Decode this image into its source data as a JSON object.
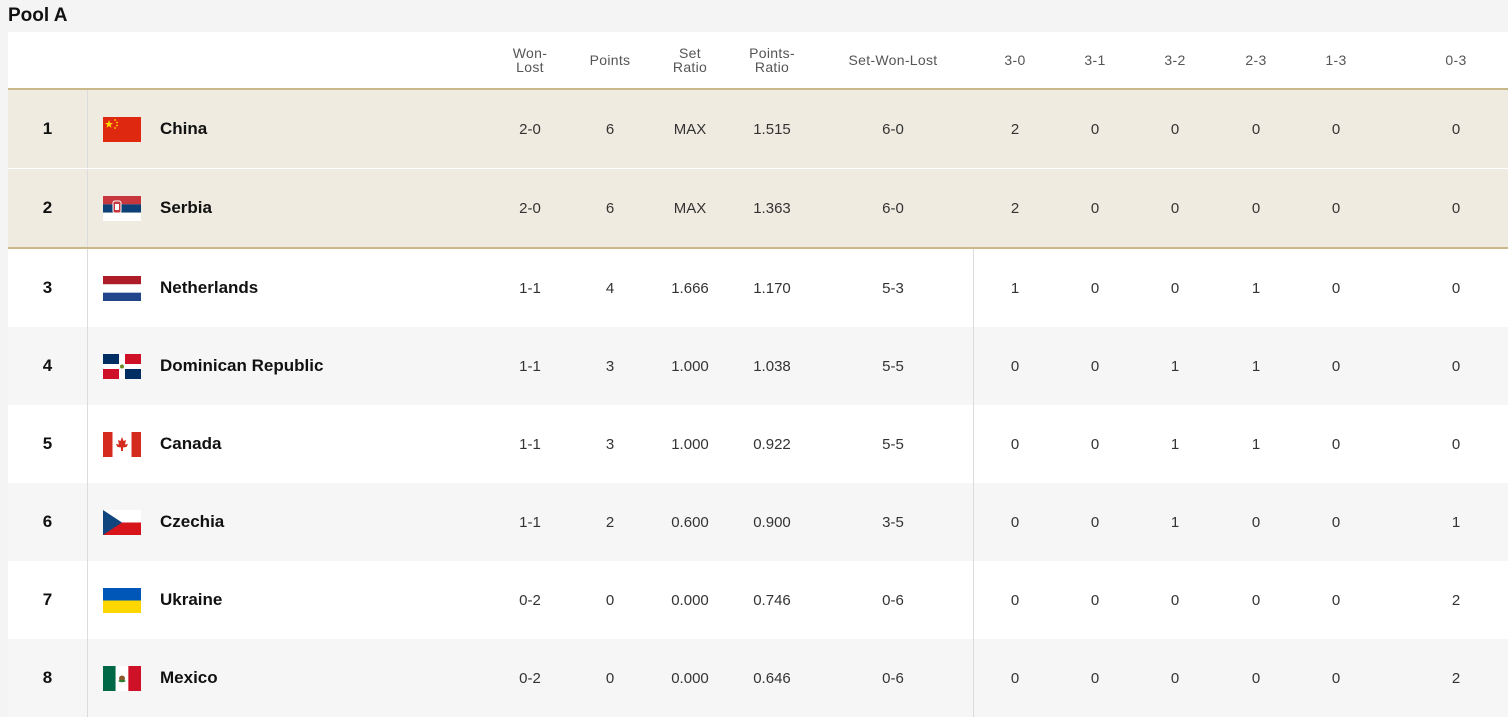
{
  "pool": {
    "title": "Pool A"
  },
  "headers": {
    "won_lost": "Won-\nLost",
    "points": "Points",
    "set_ratio": "Set\nRatio",
    "points_ratio": "Points-\nRatio",
    "set_won_lost": "Set-Won-Lost",
    "r30": "3-0",
    "r31": "3-1",
    "r32": "3-2",
    "r23": "2-3",
    "r13": "1-3",
    "r03": "0-3"
  },
  "colors": {
    "qualified_row": "#efebe0",
    "qualified_border": "#c8b88a"
  },
  "rows": [
    {
      "rank": "1",
      "team": "China",
      "flag": "china-flag-icon",
      "won_lost": "2-0",
      "points": "6",
      "set_ratio": "MAX",
      "points_ratio": "1.515",
      "set_won_lost": "6-0",
      "r30": "2",
      "r31": "0",
      "r32": "0",
      "r23": "0",
      "r13": "0",
      "r03": "0"
    },
    {
      "rank": "2",
      "team": "Serbia",
      "flag": "serbia-flag-icon",
      "won_lost": "2-0",
      "points": "6",
      "set_ratio": "MAX",
      "points_ratio": "1.363",
      "set_won_lost": "6-0",
      "r30": "2",
      "r31": "0",
      "r32": "0",
      "r23": "0",
      "r13": "0",
      "r03": "0"
    },
    {
      "rank": "3",
      "team": "Netherlands",
      "flag": "netherlands-flag-icon",
      "won_lost": "1-1",
      "points": "4",
      "set_ratio": "1.666",
      "points_ratio": "1.170",
      "set_won_lost": "5-3",
      "r30": "1",
      "r31": "0",
      "r32": "0",
      "r23": "1",
      "r13": "0",
      "r03": "0"
    },
    {
      "rank": "4",
      "team": "Dominican Republic",
      "flag": "dominican-republic-flag-icon",
      "won_lost": "1-1",
      "points": "3",
      "set_ratio": "1.000",
      "points_ratio": "1.038",
      "set_won_lost": "5-5",
      "r30": "0",
      "r31": "0",
      "r32": "1",
      "r23": "1",
      "r13": "0",
      "r03": "0"
    },
    {
      "rank": "5",
      "team": "Canada",
      "flag": "canada-flag-icon",
      "won_lost": "1-1",
      "points": "3",
      "set_ratio": "1.000",
      "points_ratio": "0.922",
      "set_won_lost": "5-5",
      "r30": "0",
      "r31": "0",
      "r32": "1",
      "r23": "1",
      "r13": "0",
      "r03": "0"
    },
    {
      "rank": "6",
      "team": "Czechia",
      "flag": "czechia-flag-icon",
      "won_lost": "1-1",
      "points": "2",
      "set_ratio": "0.600",
      "points_ratio": "0.900",
      "set_won_lost": "3-5",
      "r30": "0",
      "r31": "0",
      "r32": "1",
      "r23": "0",
      "r13": "0",
      "r03": "1"
    },
    {
      "rank": "7",
      "team": "Ukraine",
      "flag": "ukraine-flag-icon",
      "won_lost": "0-2",
      "points": "0",
      "set_ratio": "0.000",
      "points_ratio": "0.746",
      "set_won_lost": "0-6",
      "r30": "0",
      "r31": "0",
      "r32": "0",
      "r23": "0",
      "r13": "0",
      "r03": "2"
    },
    {
      "rank": "8",
      "team": "Mexico",
      "flag": "mexico-flag-icon",
      "won_lost": "0-2",
      "points": "0",
      "set_ratio": "0.000",
      "points_ratio": "0.646",
      "set_won_lost": "0-6",
      "r30": "0",
      "r31": "0",
      "r32": "0",
      "r23": "0",
      "r13": "0",
      "r03": "2"
    }
  ]
}
